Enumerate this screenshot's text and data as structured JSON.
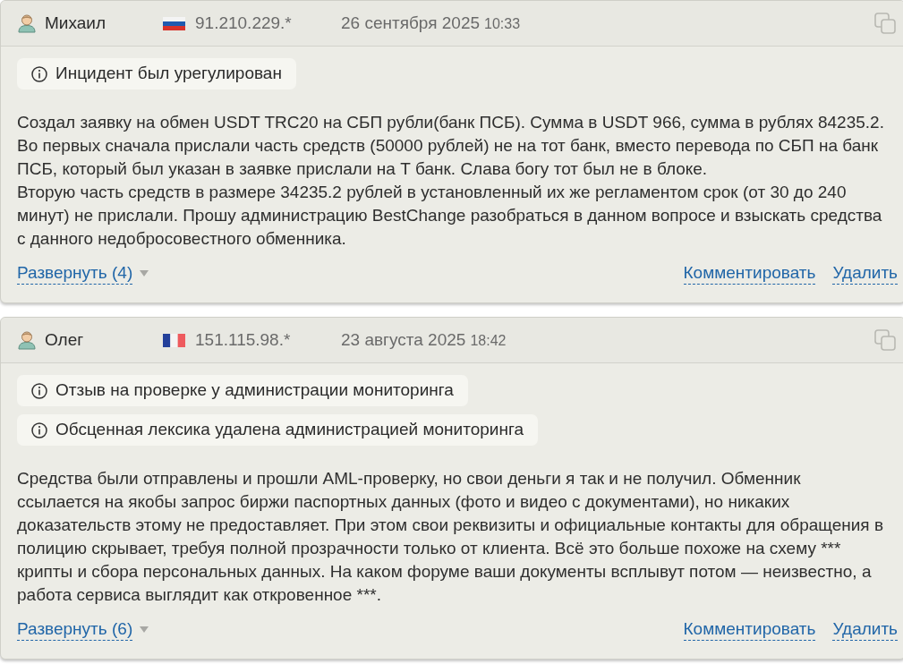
{
  "reviews": [
    {
      "author": "Михаил",
      "flag": {
        "kind": "russia"
      },
      "ip": "91.210.229.*",
      "date": "26 сентября 2025",
      "time": "10:33",
      "notices": [
        "Инцидент был урегулирован"
      ],
      "paragraphs": [
        "Создал заявку на обмен USDT TRC20 на СБП рубли(банк ПСБ). Сумма в USDT 966, сумма в рублях 84235.2. Во первых сначала прислали часть средств (50000 рублей) не на тот банк, вместо перевода по СБП на банк ПСБ, который был указан в заявке прислали на Т банк. Слава богу тот был не в блоке.",
        "Вторую часть средств в размере 34235.2 рублей в установленный их же регламентом срок (от 30 до 240 минут) не прислали. Прошу администрацию BestChange разобраться в данном вопросе и взыскать средства с данного недобросовестного обменника."
      ],
      "expand": "Развернуть (4)",
      "actions": [
        "Комментировать",
        "Удалить"
      ]
    },
    {
      "author": "Олег",
      "flag": {
        "kind": "france"
      },
      "ip": "151.115.98.*",
      "date": "23 августа 2025",
      "time": "18:42",
      "notices": [
        "Отзыв на проверке у администрации мониторинга",
        "Обсценная лексика удалена администрацией мониторинга"
      ],
      "paragraphs": [
        "Средства были отправлены и прошли AML-проверку, но свои деньги я так и не получил. Обменник ссылается на якобы запрос биржи паспортных данных (фото и видео с документами), но никаких доказательств этому не предоставляет. При этом свои реквизиты и официальные контакты для обращения в полицию скрывает, требуя полной прозрачности только от клиента. Всё это больше похоже на схему *** крипты и сбора персональных данных. На каком форуме ваши документы всплывут потом — неизвестно, а работа сервиса выглядит как откровенное ***."
      ],
      "expand": "Развернуть (6)",
      "actions": [
        "Комментировать",
        "Удалить"
      ]
    }
  ]
}
